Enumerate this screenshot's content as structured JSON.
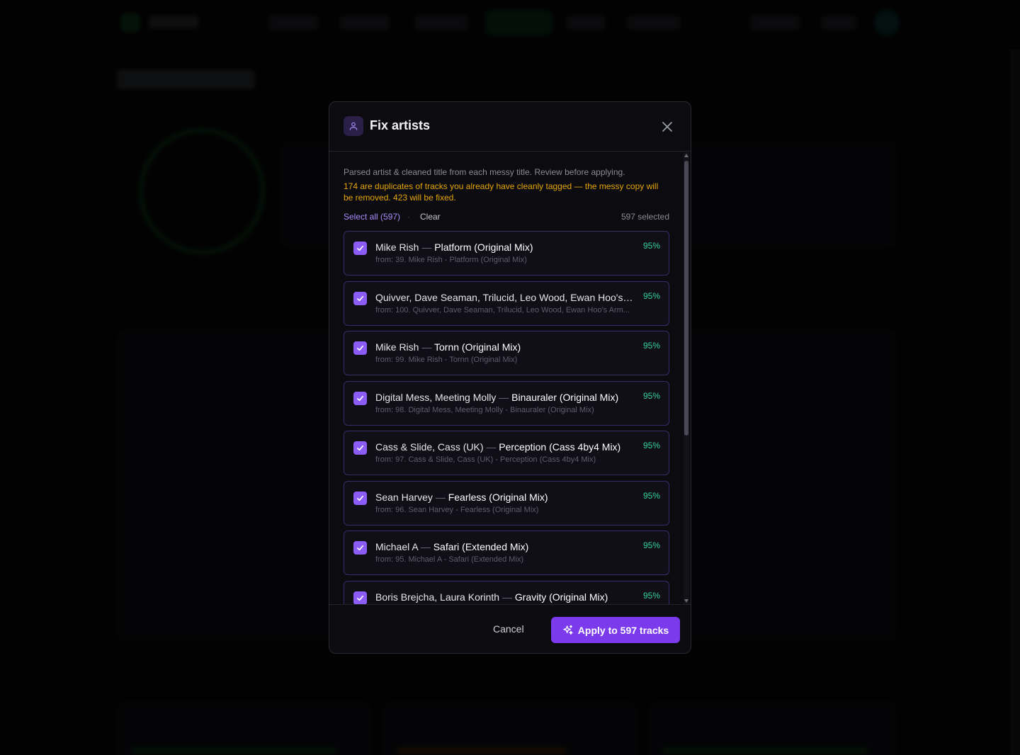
{
  "modal": {
    "title": "Fix artists",
    "header_icon": "user-icon",
    "description": "Parsed artist & cleaned title from each messy title. Review before applying.",
    "warning": "174 are duplicates of tracks you already have cleanly tagged — the messy copy will be removed. 423 will be fixed.",
    "select_all_label": "Select all (597)",
    "separator": "·",
    "clear_label": "Clear",
    "selected_count": "597 selected",
    "cancel_label": "Cancel",
    "apply_label": "Apply to 597 tracks",
    "apply_icon": "sparkles-icon",
    "colors": {
      "accent": "#7c3aed",
      "warning": "#e5a50a",
      "confidence": "#34d399"
    }
  },
  "items": [
    {
      "artist": "Mike Rish",
      "title": "Platform (Original Mix)",
      "from": "from: 39. Mike Rish - Platform (Original Mix)",
      "confidence": "95%",
      "checked": true
    },
    {
      "artist": "Quivver, Dave Seaman, Trilucid, Leo Wood, Ewan Hoo's Arm...",
      "title": "",
      "from": "from: 100. Quivver, Dave Seaman, Trilucid, Leo Wood, Ewan Hoo's Arm...",
      "confidence": "95%",
      "checked": true
    },
    {
      "artist": "Mike Rish",
      "title": "Tornn (Original Mix)",
      "from": "from: 99. Mike Rish - Tornn (Original Mix)",
      "confidence": "95%",
      "checked": true
    },
    {
      "artist": "Digital Mess, Meeting Molly",
      "title": "Binauraler (Original Mix)",
      "from": "from: 98. Digital Mess, Meeting Molly - Binauraler (Original Mix)",
      "confidence": "95%",
      "checked": true
    },
    {
      "artist": "Cass & Slide, Cass (UK)",
      "title": "Perception (Cass 4by4 Mix)",
      "from": "from: 97. Cass & Slide, Cass (UK) - Perception (Cass 4by4 Mix)",
      "confidence": "95%",
      "checked": true
    },
    {
      "artist": "Sean Harvey",
      "title": "Fearless (Original Mix)",
      "from": "from: 96. Sean Harvey - Fearless (Original Mix)",
      "confidence": "95%",
      "checked": true
    },
    {
      "artist": "Michael A",
      "title": "Safari (Extended Mix)",
      "from": "from: 95. Michael A - Safari (Extended Mix)",
      "confidence": "95%",
      "checked": true
    },
    {
      "artist": "Boris Brejcha, Laura Korinth",
      "title": "Gravity (Original Mix)",
      "from": "",
      "confidence": "95%",
      "checked": true
    }
  ]
}
